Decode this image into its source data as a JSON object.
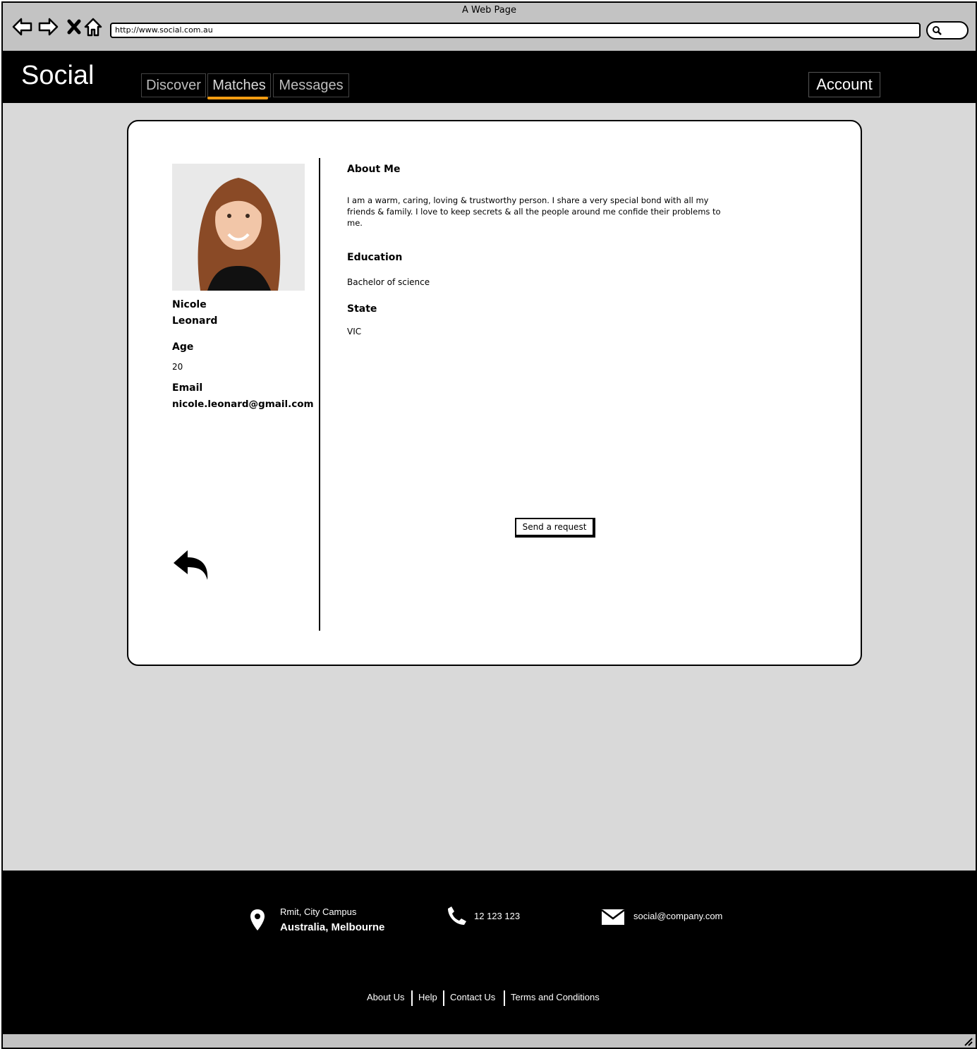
{
  "window": {
    "title": "A Web Page",
    "url": "http://www.social.com.au"
  },
  "header": {
    "logo": "Social",
    "tabs": [
      {
        "label": "Discover"
      },
      {
        "label": "Matches",
        "active": true
      },
      {
        "label": "Messages"
      }
    ],
    "account_label": "Account",
    "accent_color": "#f39c12"
  },
  "profile": {
    "first_name": "Nicole",
    "last_name": "Leonard",
    "age_label": "Age",
    "age": "20",
    "email_label": "Email",
    "email": "nicole.leonard@gmail.com",
    "about_title": "About Me",
    "about_text": "I am a warm, caring, loving & trustworthy person. I share a very special bond with all my friends & family. I love to keep secrets & all the people around me confide their problems to me.",
    "education_title": "Education",
    "education": "Bachelor of science",
    "state_title": "State",
    "state": "VIC",
    "send_request_label": "Send a request"
  },
  "footer": {
    "address_line1": "Rmit, City Campus",
    "address_line2": "Australia, Melbourne",
    "phone": "12 123 123",
    "email": "social@company.com",
    "links": [
      "About Us",
      "Help",
      "Contact Us",
      "Terms and Conditions"
    ]
  }
}
